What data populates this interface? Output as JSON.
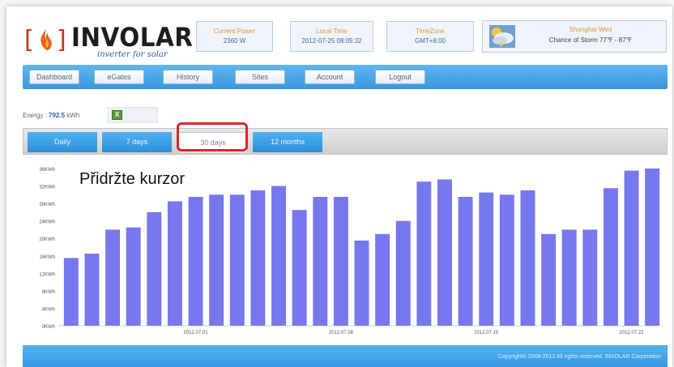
{
  "header": {
    "brand": "INVOLAR",
    "tagline": "inverter for solar",
    "current_power": {
      "label": "Current Power",
      "value": "2360 W"
    },
    "local_time": {
      "label": "Local Time",
      "value": "2012-07-25 08:05:32"
    },
    "timezone": {
      "label": "TimeZone",
      "value": "GMT+8:00"
    },
    "weather": {
      "label": "Shanghai Wed",
      "value": "Chance of Storm 77℉ - 87℉",
      "icon": "weather-storm-icon"
    }
  },
  "nav": {
    "items": [
      "Dashboard",
      "eGates",
      "History",
      "Sites",
      "Account",
      "Logout"
    ]
  },
  "energy": {
    "label": "Energy :",
    "value": "792.5",
    "unit": "kWh",
    "export_icon": "excel-icon"
  },
  "tabs": {
    "items": [
      "Daily",
      "7 days",
      "30 days",
      "12 months"
    ],
    "active": "30 days"
  },
  "overlay": {
    "text": "Přidržte kurzor"
  },
  "chart_data": {
    "type": "bar",
    "color": "#7777ee",
    "y_ticks": [
      "0KWh",
      "4KWh",
      "8KWh",
      "12KWh",
      "16KWh",
      "20KWh",
      "24KWh",
      "28KWh",
      "32KWh",
      "36KWh"
    ],
    "ylim": [
      0,
      36
    ],
    "x_labels": [
      {
        "label": "2012.07.01",
        "index": 6
      },
      {
        "label": "2012.07.08",
        "index": 13
      },
      {
        "label": "2012.07.15",
        "index": 20
      },
      {
        "label": "2012.07.22",
        "index": 27
      }
    ],
    "values": [
      15.5,
      16.5,
      22.0,
      22.5,
      26.0,
      28.5,
      29.5,
      30.0,
      30.0,
      31.0,
      32.0,
      26.5,
      29.5,
      29.5,
      19.5,
      21.0,
      24.0,
      33.0,
      33.5,
      29.5,
      30.5,
      30.0,
      31.0,
      21.0,
      22.0,
      22.0,
      31.5,
      35.5,
      36.0
    ]
  },
  "footer": {
    "copyright": "Copyright© 2008-2012 All rights reserved. INVOLAR Corporation"
  }
}
